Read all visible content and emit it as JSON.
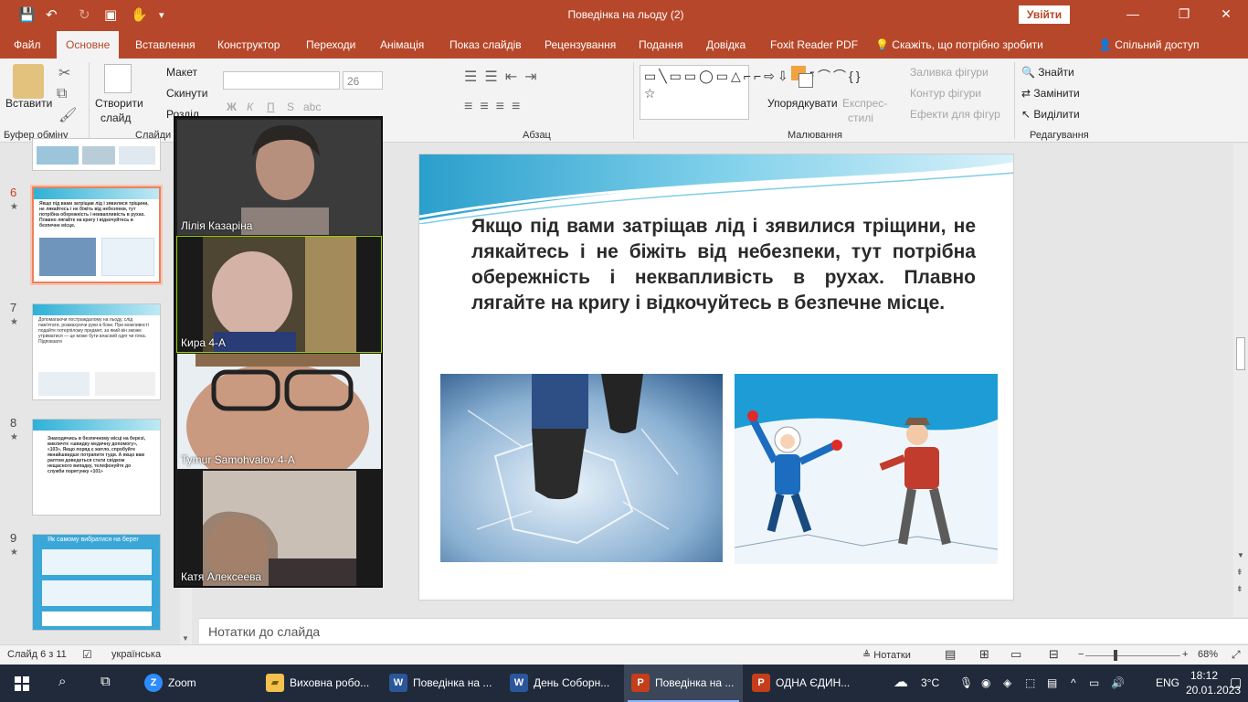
{
  "window": {
    "title": "Поведінка на льоду (2)",
    "signin": "Увійти",
    "ctrl": {
      "minimize": "—",
      "restore": "❐",
      "close": "✕"
    }
  },
  "quick_access": {
    "save": "💾",
    "undo": "↶",
    "redo": "↻",
    "present": "▣",
    "touch": "✋",
    "more": "▾"
  },
  "tabs": [
    "Файл",
    "Основне",
    "Вставлення",
    "Конструктор",
    "Переходи",
    "Анімація",
    "Показ слайдів",
    "Рецензування",
    "Подання",
    "Довідка",
    "Foxit Reader PDF"
  ],
  "tell_me": "Скажіть, що потрібно зробити",
  "share": "Спільний доступ",
  "ribbon": {
    "paste": "Вставити",
    "clipboard_group": "Буфер обміну",
    "new_slide": "Створити",
    "new_slide2": "слайд",
    "layout": "Макет",
    "reset": "Скинути",
    "section": "Розділ",
    "slides_group": "Слайди",
    "font_size": "26",
    "paragraph_group": "Абзац",
    "arrange": "Упорядкувати",
    "quick_styles": "Експрес-",
    "quick_styles2": "стилі",
    "shape_fill": "Заливка фігури",
    "shape_outline": "Контур фігури",
    "shape_effects": "Ефекти для фігур",
    "drawing_group": "Малювання",
    "find": "Знайти",
    "replace": "Замінити",
    "select": "Виділити",
    "editing_group": "Редагування",
    "bold": "Ж",
    "italic": "К",
    "underline": "П",
    "strike": "S",
    "shadow": "abc",
    "shapes_glyphs": "▭╲▭▭◯▭△⌐⌐⇨⇩⇨↺⌒⌒{}☆"
  },
  "thumbnails": [
    {
      "num": "6",
      "text": "Якщо під вами затріщав лід і зявилися тріщини, не лякайтесь і не біжіть від небезпеки, тут потрібна обережність і неквапливість в рухах. Плавно лягайте на кригу і відкочуйтесь в безпечне місце."
    },
    {
      "num": "7",
      "text": "Допомагаючи постраждалому на льоду, слід пам'ятати, розмахуючи руки в боки. При можливості подайте потерпілому предмет, за який він зможе утриматися — це може бути власний одяг чи гілка. Підповзати"
    },
    {
      "num": "8",
      "text": "Знаходячись в безпечному місці на березі, викличте «швидку медичну допомогу», «103». Якщо поряд є житло, спробуйте якнайшвидше потрапити туди. А якщо вам раптом доведеться стати свідком нещасного випадку, телефонуйте до служби порятунку «101»"
    },
    {
      "num": "9",
      "text": "Як самому вибратися на берег"
    }
  ],
  "star": "★",
  "participants": [
    {
      "name": "Лілія Казаріна"
    },
    {
      "name": "Кира 4-А"
    },
    {
      "name": "Tymur Samohvalov 4-A"
    },
    {
      "name": "Катя Алексеева"
    }
  ],
  "slide": {
    "text": "Якщо під вами затріщав лід і зявилися тріщини, не лякайтесь і не біжіть від небезпеки, тут потрібна обережність і неквапливість в рухах. Плавно лягайте на кригу і відкочуйтесь в безпечне місце."
  },
  "notes": "Нотатки до слайда",
  "status": {
    "slide": "Слайд 6 з 11",
    "language": "українська",
    "notes_btn": "Нотатки",
    "zoom": "68%"
  },
  "taskbar": {
    "items": [
      {
        "label": "Zoom",
        "icon": "Z",
        "color": "#2d8cff"
      },
      {
        "label": "Виховна робо...",
        "icon": "▰",
        "color": "#f2c14e"
      },
      {
        "label": "Поведінка на ...",
        "icon": "W",
        "color": "#2b579a"
      },
      {
        "label": "День Соборн...",
        "icon": "W",
        "color": "#2b579a"
      },
      {
        "label": "Поведінка на ...",
        "icon": "P",
        "color": "#c43e1c"
      },
      {
        "label": "ОДНА ЄДИН...",
        "icon": "P",
        "color": "#c43e1c"
      }
    ],
    "weather": "3°C",
    "lang": "ENG",
    "time": "18:12",
    "date": "20.01.2023"
  }
}
